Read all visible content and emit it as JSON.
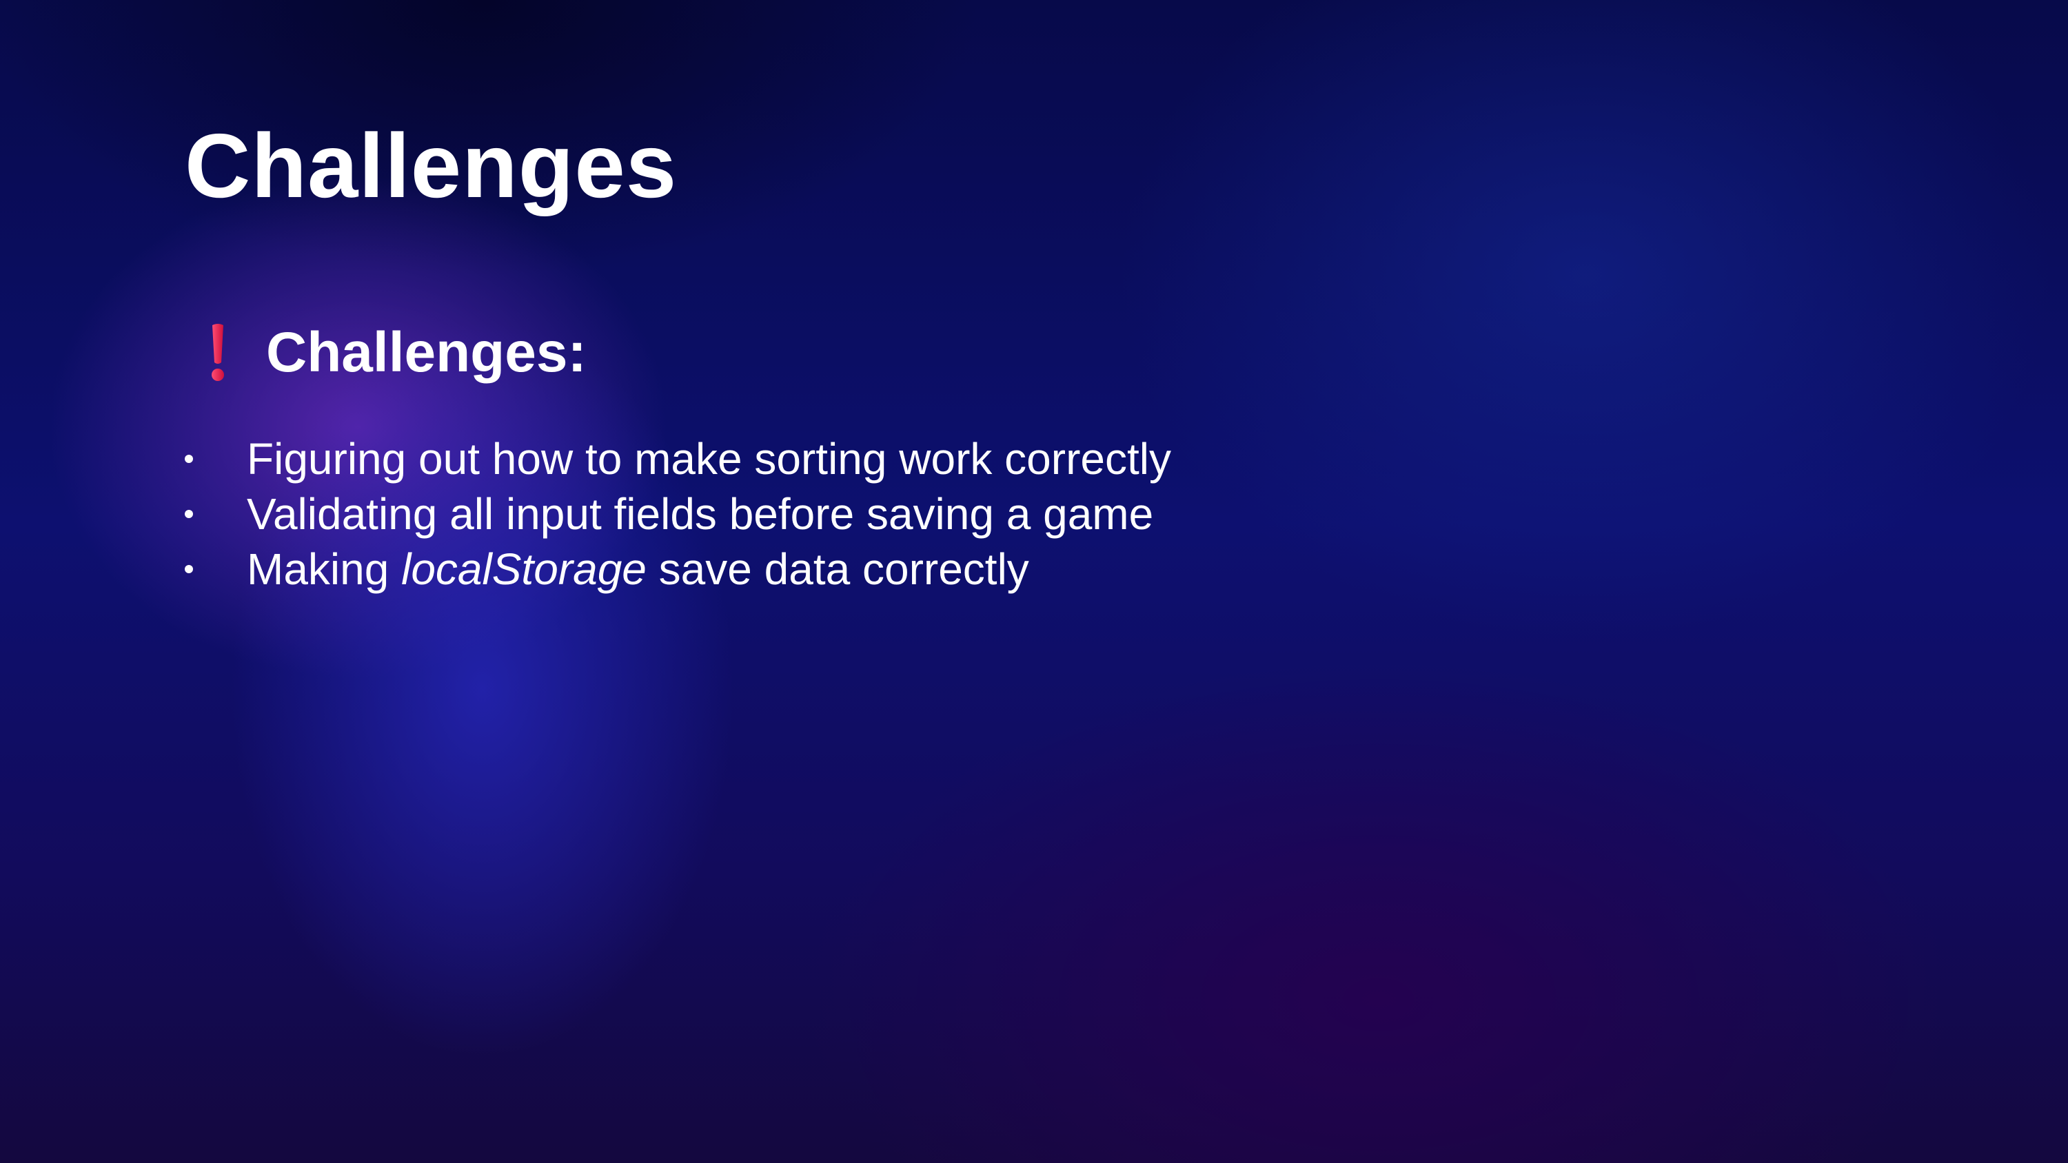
{
  "slide": {
    "title": "Challenges",
    "subheading": {
      "icon": "red-exclamation-icon",
      "icon_color": "#e8214f",
      "text": "Challenges:"
    },
    "bullets": [
      {
        "text": "Figuring out how to make sorting work correctly"
      },
      {
        "text": "Validating all input fields before saving a game"
      },
      {
        "prefix": "Making ",
        "emphasis": "localStorage",
        "suffix": " save data correctly"
      }
    ]
  },
  "colors": {
    "text": "#ffffff",
    "background_top": "#070a4a",
    "background_bottom": "#14083f",
    "accent_purple": "#6028b4"
  }
}
